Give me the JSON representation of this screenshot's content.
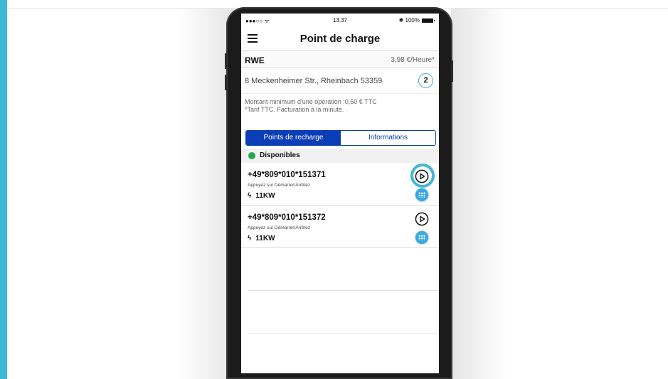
{
  "status_bar": {
    "signal": "●●●○○ ᯤ",
    "time": "13:37",
    "battery": "✱ 100%"
  },
  "navbar": {
    "title": "Point de charge"
  },
  "station": {
    "operator": "RWE",
    "price": "3,98 €/Heure*",
    "address": "8 Meckenheimer Str., Rheinbach 53359",
    "count": "2",
    "note_line1": "Montant minimum d'une opération :0,50 € TTC",
    "note_line2": "*Tarif TTC. Facturation à la minute."
  },
  "tabs": [
    {
      "label": "Points de recharge",
      "active": true
    },
    {
      "label": "Informations",
      "active": false
    }
  ],
  "section": {
    "label": "Disponibles",
    "status_color": "#23a84a"
  },
  "chargers": [
    {
      "id": "+49*809*010*151371",
      "hint": "Appuyez sur Démarrer/Arrêtez",
      "power": "11KW",
      "highlighted": true
    },
    {
      "id": "+49*809*010*151372",
      "hint": "Appuyez sur Démarrer/Arrêtez",
      "power": "11KW",
      "highlighted": false
    }
  ],
  "colors": {
    "accent": "#0b3eb6",
    "highlight": "#3fb7d9",
    "available": "#23a84a"
  },
  "icons": [
    "menu-icon",
    "play-icon",
    "plug-icon",
    "bolt-icon"
  ]
}
